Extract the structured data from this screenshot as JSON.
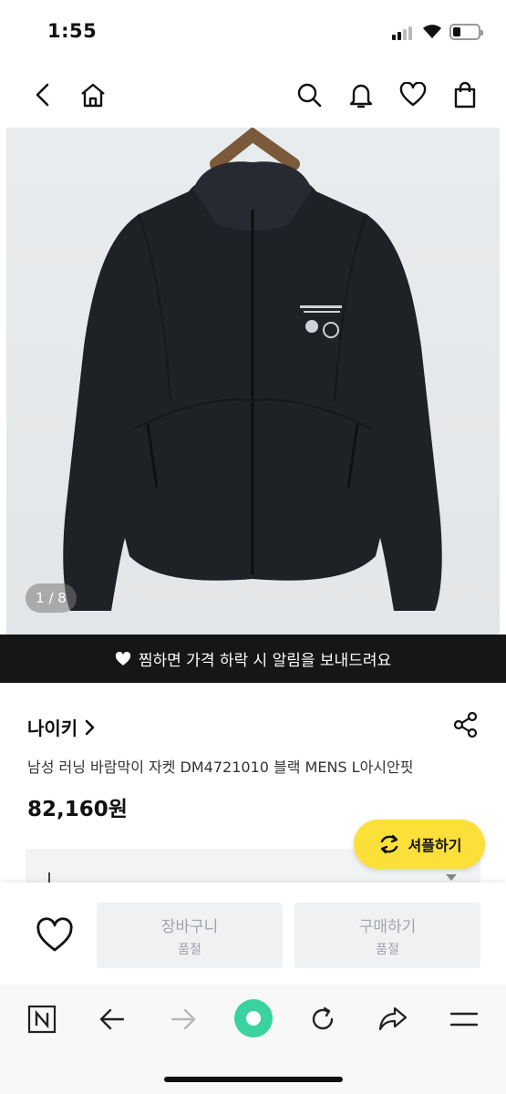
{
  "status": {
    "time": "1:55"
  },
  "product": {
    "image_counter": "1 / 8",
    "wish_notice": "찜하면 가격 하락 시 알림을 보내드려요",
    "brand": "나이키",
    "name": "남성 러닝 바람막이 자켓 DM4721010 블랙 MENS L아시안핏",
    "price": "82,160원"
  },
  "shuffle": {
    "label": "셔플하기"
  },
  "actions": {
    "cart": {
      "label": "장바구니",
      "status": "품절"
    },
    "buy": {
      "label": "구매하기",
      "status": "품절"
    }
  },
  "icons": {
    "nav": [
      "back-icon",
      "home-icon",
      "search-icon",
      "bell-icon",
      "heart-icon",
      "shopping-bag-icon"
    ],
    "browser": [
      "naver-n-icon",
      "arrow-left-icon",
      "arrow-right-icon",
      "green-dot-icon",
      "refresh-icon",
      "share-arrow-icon",
      "menu-icon"
    ]
  },
  "colors": {
    "accent_yellow": "#fbe03a",
    "banner_black": "#161616",
    "naver_green": "#3ad29f"
  }
}
